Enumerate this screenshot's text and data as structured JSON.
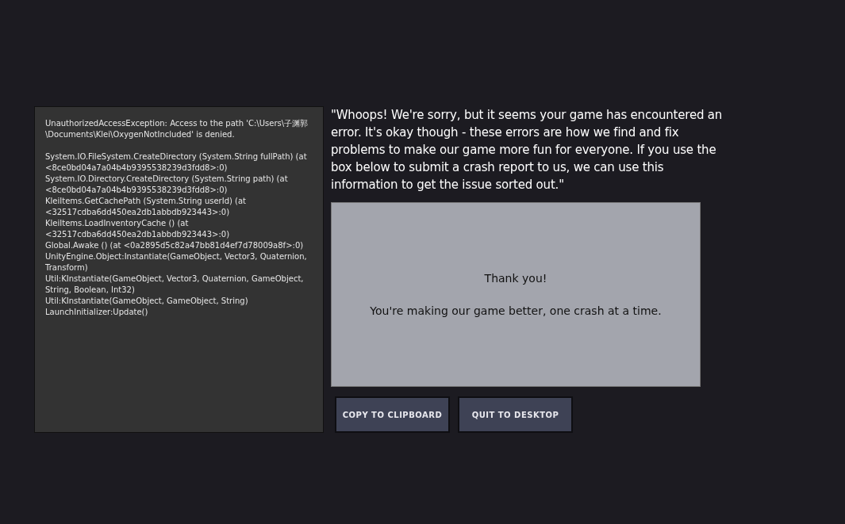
{
  "error_log": {
    "message": "UnauthorizedAccessException: Access to the path 'C:\\Users\\子渊郭\\Documents\\Klei\\OxygenNotIncluded' is denied.",
    "stack": [
      "System.IO.FileSystem.CreateDirectory (System.String fullPath) (at <8ce0bd04a7a04b4b9395538239d3fdd8>:0)",
      "System.IO.Directory.CreateDirectory (System.String path) (at <8ce0bd04a7a04b4b9395538239d3fdd8>:0)",
      "KleiItems.GetCachePath (System.String userId) (at <32517cdba6dd450ea2db1abbdb923443>:0)",
      "KleiItems.LoadInventoryCache () (at <32517cdba6dd450ea2db1abbdb923443>:0)",
      "Global.Awake () (at <0a2895d5c82a47bb81d4ef7d78009a8f>:0)",
      "UnityEngine.Object:Instantiate(GameObject, Vector3, Quaternion, Transform)",
      "Util:KInstantiate(GameObject, Vector3, Quaternion, GameObject, String, Boolean, Int32)",
      "Util:KInstantiate(GameObject, GameObject, String)",
      "LaunchInitializer:Update()"
    ]
  },
  "apology": "\"Whoops! We're sorry, but it seems your game has encountered an error. It's okay though - these errors are how we find and fix problems to make our game more fun for everyone. If you use the box below to submit a crash report to us, we can use this information to get the issue sorted out.\"",
  "report_box": {
    "title": "Thank you!",
    "message": "You're making our game better, one crash at a time."
  },
  "buttons": [
    "COPY TO CLIPBOARD",
    "QUIT TO DESKTOP"
  ]
}
